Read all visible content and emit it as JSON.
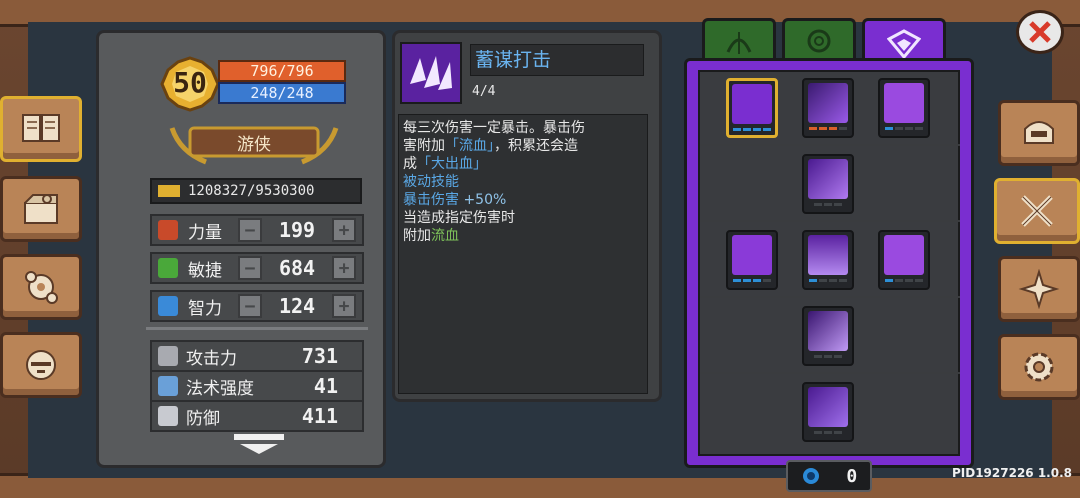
{
  "hero": {
    "level": "50",
    "hp": "796/796",
    "mp": "248/248",
    "class_name": "游侠",
    "exp": "1208327/9530300"
  },
  "attributes": [
    {
      "label": "力量",
      "value": "199"
    },
    {
      "label": "敏捷",
      "value": "684"
    },
    {
      "label": "智力",
      "value": "124"
    }
  ],
  "combat_stats": [
    {
      "label": "攻击力",
      "value": "731"
    },
    {
      "label": "法术强度",
      "value": "41"
    },
    {
      "label": "防御",
      "value": "411"
    }
  ],
  "skill_detail": {
    "name": "蓄谋打击",
    "rank": "4/4",
    "desc_lines": [
      {
        "parts": [
          {
            "text": "每三次伤害一定暴击。暴击伤",
            "color": "#e8e8e8"
          }
        ]
      },
      {
        "parts": [
          {
            "text": "害附加",
            "color": "#e8e8e8"
          },
          {
            "text": "「流血」",
            "color": "#5aa8e6"
          },
          {
            "text": "，积累还会造",
            "color": "#e8e8e8"
          }
        ]
      },
      {
        "parts": [
          {
            "text": "成",
            "color": "#e8e8e8"
          },
          {
            "text": "「大出血」",
            "color": "#5aa8e6"
          }
        ]
      },
      {
        "parts": [
          {
            "text": "被动技能",
            "color": "#5aa8e6"
          }
        ]
      },
      {
        "parts": [
          {
            "text": "暴击伤害 ",
            "color": "#5aa8e6"
          },
          {
            "text": "+50%",
            "color": "#8fc2e8"
          }
        ]
      },
      {
        "parts": [
          {
            "text": "当造成指定伤害时",
            "color": "#e8e8e8"
          }
        ]
      },
      {
        "parts": [
          {
            "text": "附加",
            "color": "#e8e8e8"
          },
          {
            "text": "流血",
            "color": "#7ec25a"
          }
        ]
      }
    ]
  },
  "tabs": [
    {
      "name": "bow-icon",
      "color": "#2f6a2a"
    },
    {
      "name": "swirl-icon",
      "color": "#2f6a2a"
    },
    {
      "name": "rogue-emblem-icon",
      "color": "#7a2ed0"
    }
  ],
  "currency": {
    "value": "0"
  },
  "version": "PID1927226 1.0.8",
  "colors": {
    "accent_purple": "#7a2ed0",
    "hp": "#e0602c",
    "mp": "#3a7ad0",
    "gold": "#e0b030"
  }
}
